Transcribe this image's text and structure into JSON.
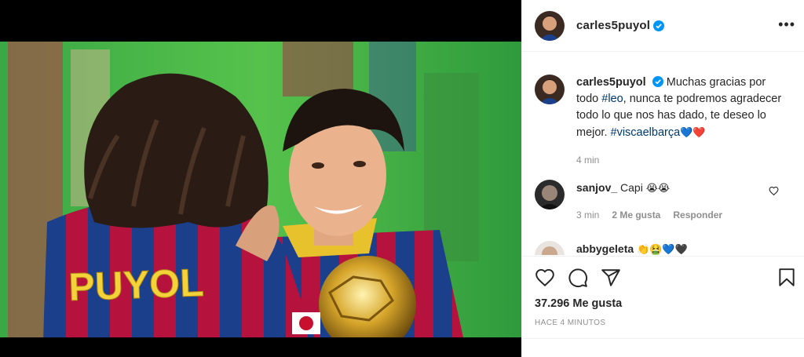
{
  "post": {
    "username": "carles5puyol",
    "caption_lead": "Muchas gracias por todo ",
    "caption_tag1": "#leo",
    "caption_mid": ", nunca te podremos agradecer todo lo que nos has dado, te deseo lo mejor. ",
    "caption_tag2": "#viscaelbarça",
    "caption_emojis": "💙❤️",
    "caption_time": "4 min",
    "likes": "37.296 Me gusta",
    "posted": "HACE 4 MINUTOS"
  },
  "comments": [
    {
      "username": "sanjov_",
      "text": "Capi",
      "emojis": "😭😭",
      "time": "3 min",
      "likes": "2 Me gusta",
      "reply": "Responder"
    },
    {
      "username": "abbygeleta",
      "text": "",
      "emojis": "👏🤮💙🖤"
    }
  ],
  "jersey_text": "PUYOL",
  "colors": {
    "accent": "#0095f6",
    "hashtag": "#00376b",
    "muted": "#8e8e8e",
    "barca_blue": "#1b3f8b",
    "barca_red": "#b5123e",
    "pitch_green": "#3fb34a"
  },
  "icons": [
    "verified-badge-icon",
    "more-options-icon",
    "heart-icon",
    "comment-icon",
    "share-icon",
    "bookmark-icon"
  ]
}
